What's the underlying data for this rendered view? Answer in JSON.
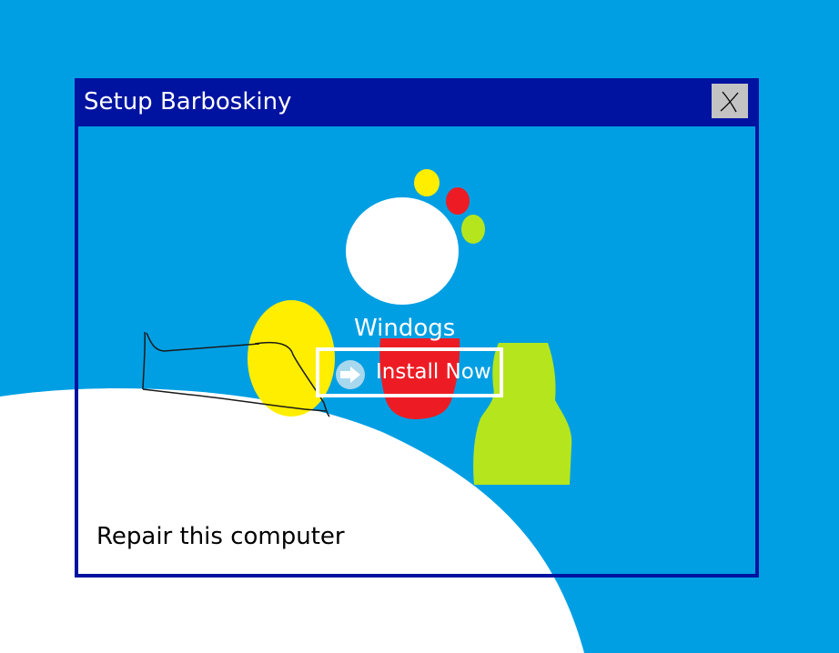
{
  "window": {
    "title": "Setup Barboskiny",
    "close_label": "X"
  },
  "logo": {
    "product_name": "Windogs"
  },
  "install": {
    "label": "Install Now"
  },
  "repair": {
    "label": "Repair this computer"
  },
  "colors": {
    "desktop_blue": "#009fe3",
    "title_bar": "#0013a0",
    "yellow": "#ffee00",
    "red": "#ed1c24",
    "green": "#b5e61d",
    "white": "#ffffff",
    "close_button": "#c3c3c3"
  },
  "icons": {
    "install": "arrow-right-icon",
    "close": "close-icon"
  }
}
